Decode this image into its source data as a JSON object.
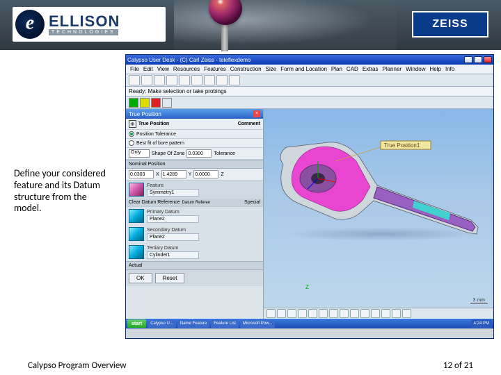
{
  "header": {
    "logo_name": "ELLISON",
    "logo_sub": "TECHNOLOGIES",
    "partner": "ZEISS"
  },
  "description": "Define your considered feature and its Datum structure from the model.",
  "app": {
    "title": "Calypso User Desk - (C) Carl Zeiss - teleflexdemo",
    "menus": [
      "File",
      "Edit",
      "View",
      "Resources",
      "Features",
      "Construction",
      "Size",
      "Form and Location",
      "Plan",
      "CAD",
      "Extras",
      "Planner",
      "Window",
      "Help",
      "Info"
    ],
    "status": "Ready: Make selection or take probings",
    "panel": {
      "title": "True Position",
      "header_row": {
        "col1": "True Position",
        "col2": "Comment"
      },
      "opt_position_tolerance": "Position Tolerance",
      "opt_best_fit": "Best fit of bore pattern",
      "zone_label": "Shape Of Zone",
      "zone_mode": "Only",
      "zone_val": "0.0300",
      "zone_tol_label": "Tolerance",
      "nominal_label": "Nominal Position",
      "nom_x": "0.0303",
      "nom_y": "1.4289",
      "nom_z": "0.0000",
      "feature_label": "Feature",
      "feature_val": "Symmetry1",
      "clear_datum": "Clear Datum Reference",
      "datum_ref": "Datum Referen",
      "special": "Special",
      "primary_label": "Primary Datum",
      "primary_val": "Plane2",
      "secondary_label": "Secondary Datum",
      "secondary_val": "Plane2",
      "tertiary_label": "Tertiary Datum",
      "tertiary_val": "Cylinder1",
      "actual_label": "Actual",
      "ok": "OK",
      "reset": "Reset"
    },
    "viewport": {
      "annotation": "True Position1",
      "scale": "3 mm"
    },
    "taskbar": {
      "start": "start",
      "items": [
        "Calypso U...",
        "Name Feature",
        "Feature List",
        "Microsoft Pow..."
      ],
      "time": "4:24 PM"
    }
  },
  "footer": {
    "left": "Calypso Program Overview",
    "right_a": "12",
    "right_b": "of",
    "right_c": "21"
  }
}
